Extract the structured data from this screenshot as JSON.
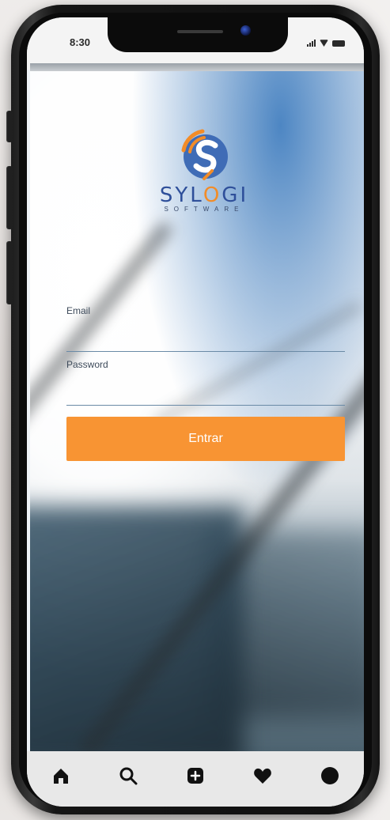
{
  "status_bar": {
    "time": "8:30"
  },
  "logo": {
    "name_main": "SYL",
    "name_accent": "O",
    "name_end": "GI",
    "subtitle": "SOFTWARE",
    "colors": {
      "blue": "#2e4f9a",
      "orange": "#f28c28"
    }
  },
  "login_form": {
    "email_label": "Email",
    "email_value": "",
    "password_label": "Password",
    "password_value": "",
    "submit_label": "Entrar",
    "submit_color": "#f89433"
  },
  "bottom_nav": {
    "items": [
      {
        "icon": "home-icon"
      },
      {
        "icon": "search-icon"
      },
      {
        "icon": "add-icon"
      },
      {
        "icon": "heart-icon"
      },
      {
        "icon": "profile-icon"
      }
    ]
  }
}
